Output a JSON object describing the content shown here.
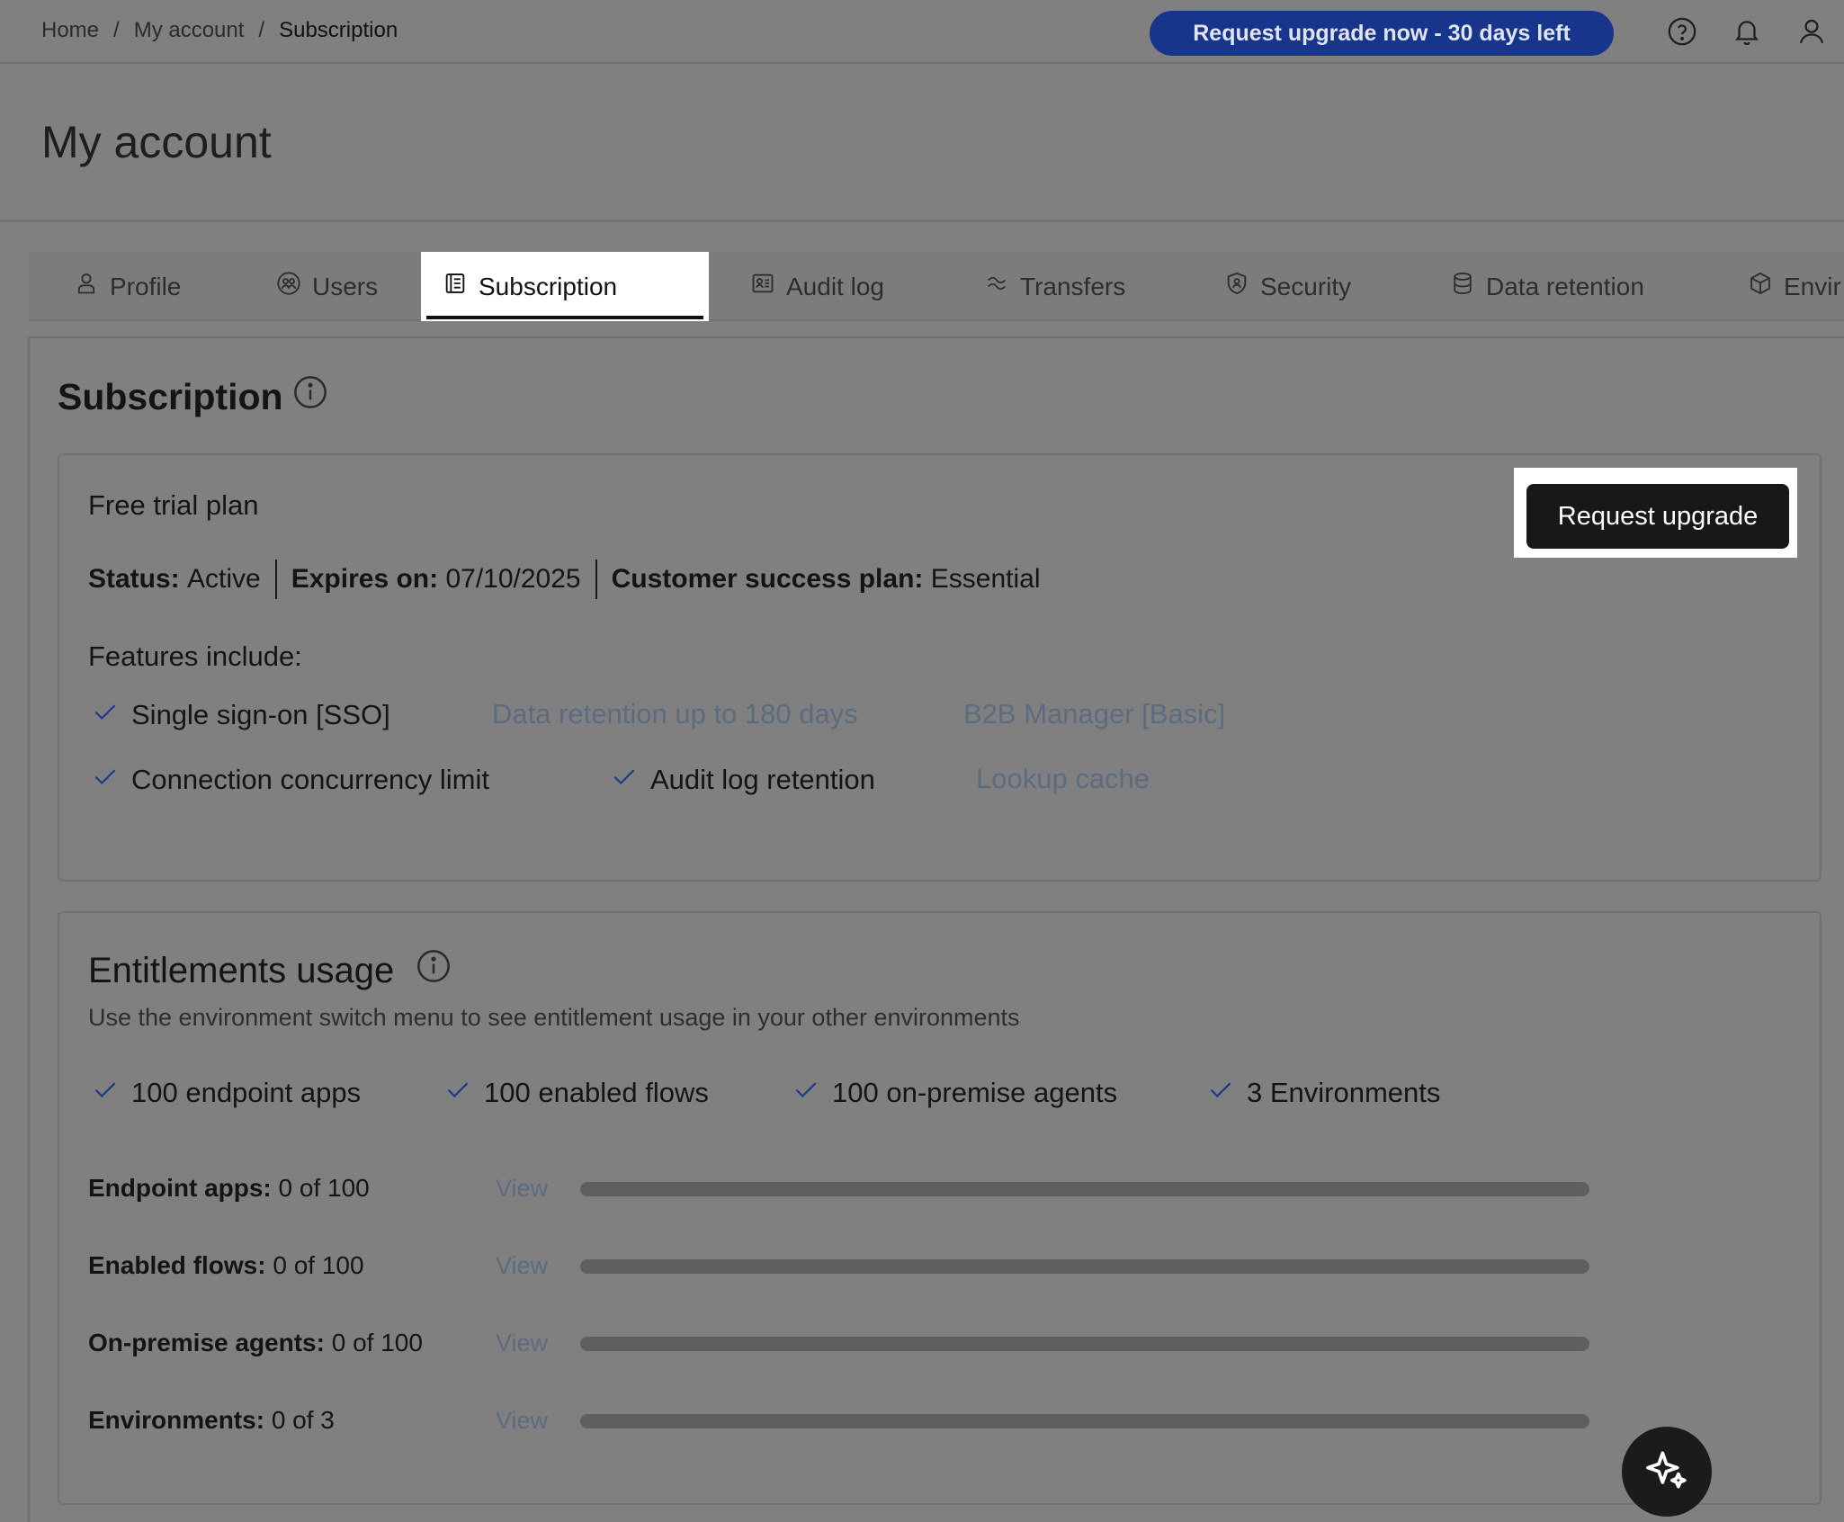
{
  "breadcrumb": {
    "items": [
      "Home",
      "My account",
      "Subscription"
    ],
    "separator": "/"
  },
  "topbar": {
    "promo_label": "Request upgrade now - 30 days left",
    "icons": [
      "help-icon",
      "bell-icon",
      "user-icon"
    ]
  },
  "header": {
    "title": "My account"
  },
  "tabs": [
    {
      "label": "Profile",
      "icon": "user-icon"
    },
    {
      "label": "Users",
      "icon": "users-icon"
    },
    {
      "label": "Subscription",
      "icon": "document-icon",
      "active": true
    },
    {
      "label": "Audit log",
      "icon": "audit-icon"
    },
    {
      "label": "Transfers",
      "icon": "transfers-icon"
    },
    {
      "label": "Security",
      "icon": "shield-icon"
    },
    {
      "label": "Data retention",
      "icon": "database-icon"
    },
    {
      "label": "Envir",
      "icon": "cube-icon"
    }
  ],
  "subscription": {
    "title": "Subscription",
    "plan_name": "Free trial plan",
    "status_label": "Status:",
    "status_value": "Active",
    "expires_label": "Expires on:",
    "expires_value": "07/10/2025",
    "csp_label": "Customer success plan:",
    "csp_value": "Essential",
    "upgrade_label": "Request upgrade",
    "features_title": "Features include:",
    "features": [
      {
        "label": "Single sign-on [SSO]",
        "enabled": true
      },
      {
        "label": "Data retention up to 180 days",
        "enabled": false
      },
      {
        "label": "B2B Manager [Basic]",
        "enabled": false
      },
      {
        "label": "Connection concurrency limit",
        "enabled": true
      },
      {
        "label": "Audit log retention",
        "enabled": true
      },
      {
        "label": "Lookup cache",
        "enabled": false
      }
    ]
  },
  "entitlements": {
    "title": "Entitlements usage",
    "description": "Use the environment switch menu to see entitlement usage in your other environments",
    "summary": [
      "100 endpoint apps",
      "100 enabled flows",
      "100 on-premise agents",
      "3 Environments"
    ],
    "view_label": "View",
    "usage": [
      {
        "label": "Endpoint apps:",
        "value": "0 of 100",
        "fraction": 0
      },
      {
        "label": "Enabled flows:",
        "value": "0 of 100",
        "fraction": 0
      },
      {
        "label": "On-premise agents:",
        "value": "0 of 100",
        "fraction": 0
      },
      {
        "label": "Environments:",
        "value": "0 of 3",
        "fraction": 0
      }
    ]
  },
  "colors": {
    "promo": "#17358a",
    "overlay": "#808080",
    "disabled_text": "#5c6c80",
    "primary_button": "#18181b"
  }
}
